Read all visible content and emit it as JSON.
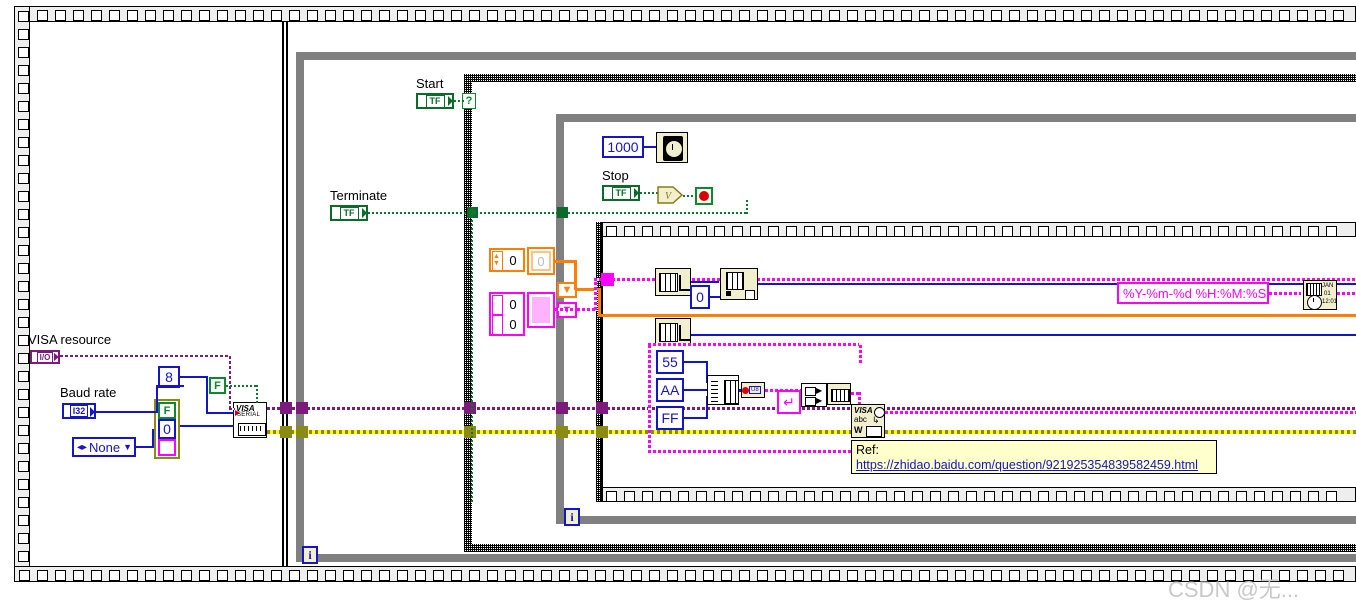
{
  "diagram": {
    "app": "LabVIEW Block Diagram",
    "watermark": "CSDN @无..."
  },
  "labels": {
    "visa_resource": "VISA resource",
    "baud_rate": "Baud rate",
    "start": "Start",
    "terminate": "Terminate",
    "stop": "Stop"
  },
  "terminals": {
    "visa_resource_type": "I/O",
    "baud_rate_type": "I32",
    "start_type": "TF",
    "terminate_type": "TF",
    "stop_type": "TF"
  },
  "constants": {
    "data_bits": "8",
    "flow_control": "None",
    "parity_false": "F",
    "parity_zero": "0",
    "enable_termchar": "F",
    "wait_ms": "1000",
    "index_zero": "0",
    "array_zero_a": "0",
    "array_zero_b": "0",
    "array_zero_c": "0",
    "array_zero_d": "0",
    "byte_55": "55",
    "byte_AA": "AA",
    "byte_FF": "FF",
    "time_format": "%Y-%m-%d %H:%M:%S"
  },
  "nodes": {
    "visa_config_serial": "VISA SERIAL",
    "wait_ms_node": "wait-ms",
    "or_node": "V",
    "stop_node": "stop",
    "index_array_top": "index-array",
    "index_array_bottom": "index-array",
    "array_subset": "array-subset",
    "build_array": "build-array",
    "u8_convert": "to-u8",
    "byte_array_to_string": "byte-array-to-string",
    "concat_string": "concat",
    "visa_write": "VISA abc W",
    "format_datetime": "JAN 01 12:01",
    "case_selector": "?",
    "loop_index_outer": "i",
    "loop_index_mid": "i",
    "loop_index_inner": "i"
  },
  "comment": {
    "title": "Ref:",
    "url": "https://zhidao.baidu.com/question/921925354839582459.html"
  },
  "colors": {
    "wire_blue": "#1414c8",
    "wire_pink": "#ff00ff",
    "wire_orange": "#ff7f00",
    "wire_purple": "#7d1b7d",
    "wire_olive": "#8a8a14",
    "wire_green": "#0a7a2a",
    "node_bg": "#f2efcf",
    "structure_grey": "#808080",
    "comment_bg": "#ffffcc"
  }
}
